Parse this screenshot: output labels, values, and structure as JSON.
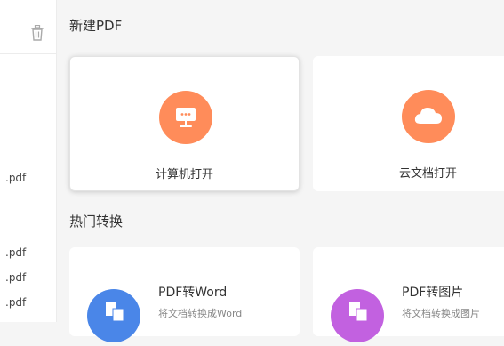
{
  "sidebar": {
    "files": [
      {
        "label": ".pdf"
      },
      {
        "label": ".pdf"
      },
      {
        "label": ".pdf"
      },
      {
        "label": ".pdf"
      }
    ]
  },
  "new_pdf": {
    "title": "新建PDF",
    "open_local_label": "计算机打开",
    "open_cloud_label": "云文档打开"
  },
  "hot_convert": {
    "title": "热门转换",
    "items": [
      {
        "title": "PDF转Word",
        "subtitle": "将文档转换成Word"
      },
      {
        "title": "PDF转图片",
        "subtitle": "将文档转换成图片"
      }
    ]
  },
  "colors": {
    "orange": "#ff8c5a",
    "blue": "#4a86e8",
    "purple": "#c261e0"
  }
}
